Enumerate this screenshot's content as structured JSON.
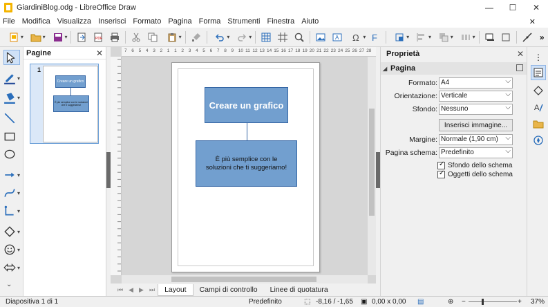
{
  "window": {
    "title": "GiardiniBlog.odg - LibreOffice Draw",
    "controls": [
      "—",
      "☐",
      "✕"
    ]
  },
  "menu": [
    "File",
    "Modifica",
    "Visualizza",
    "Inserisci",
    "Formato",
    "Pagina",
    "Forma",
    "Strumenti",
    "Finestra",
    "Aiuto"
  ],
  "pages_panel": {
    "title": "Pagine",
    "close": "✕",
    "thumbnail_number": "1"
  },
  "thumbnail": {
    "title_text": "Creare un grafico",
    "body_text": "È più semplice con le soluzioni che ti suggeriamo!"
  },
  "slide": {
    "shape_title": "Creare un grafico",
    "shape_body": "È più semplice con le soluzioni che ti suggeriamo!"
  },
  "ruler": {
    "horizontal_labels": [
      "7",
      "6",
      "5",
      "4",
      "3",
      "2",
      "1",
      "1",
      "2",
      "3",
      "4",
      "5",
      "6",
      "7",
      "8",
      "9",
      "10",
      "11",
      "12",
      "13",
      "14",
      "15",
      "16",
      "17",
      "18",
      "19",
      "20",
      "21",
      "22",
      "23",
      "24",
      "25",
      "26",
      "27",
      "28"
    ]
  },
  "tabs": {
    "items": [
      "Layout",
      "Campi di controllo",
      "Linee di quotatura"
    ],
    "active": "Layout",
    "nav": [
      "⏮",
      "◀",
      "▶",
      "⏭"
    ]
  },
  "properties": {
    "title": "Proprietà",
    "close": "✕",
    "section": "Pagina",
    "format_label": "Formato:",
    "format_value": "A4",
    "orientation_label": "Orientazione:",
    "orientation_value": "Verticale",
    "background_label": "Sfondo:",
    "background_value": "Nessuno",
    "insert_image": "Inserisci immagine...",
    "margin_label": "Margine:",
    "margin_value": "Normale (1,90 cm)",
    "master_label": "Pagina schema:",
    "master_value": "Predefinito",
    "check_bg": "Sfondo dello schema",
    "check_objects": "Oggetti dello schema"
  },
  "status": {
    "slide": "Diapositiva 1 di 1",
    "master": "Predefinito",
    "position": "-8,16 / -1,65",
    "size": "0,00 x 0,00",
    "zoom": "37%"
  },
  "colors": {
    "shape_fill": "#729fcf",
    "shape_border": "#3465a4",
    "accent": "#3b7dd8"
  }
}
